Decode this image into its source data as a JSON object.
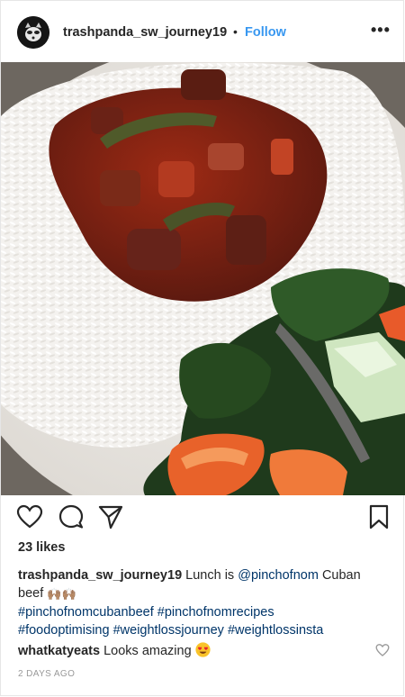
{
  "header": {
    "username": "trashpanda_sw_journey19",
    "separator": "•",
    "follow_label": "Follow",
    "more_label": "•••"
  },
  "icons": {
    "like": "heart-outline-icon",
    "comment": "speech-bubble-icon",
    "share": "paper-plane-icon",
    "save": "bookmark-icon"
  },
  "likes": "23 likes",
  "caption": {
    "username": "trashpanda_sw_journey19",
    "text_before": "Lunch is",
    "mention": "@pinchofnom",
    "text_after": "Cuban beef",
    "emoji": "🙌🏽🙌🏽",
    "hashtags": [
      "#pinchofnomcubanbeef",
      "#pinchofnomrecipes",
      "#foodoptimising",
      "#weightlossjourney",
      "#weightlossinsta"
    ]
  },
  "comment": {
    "username": "whatkatyeats",
    "text": "Looks amazing",
    "emoji": "heart-eyes-emoji"
  },
  "timestamp": "2 DAYS AGO",
  "colors": {
    "link": "#003569",
    "follow": "#3897f0",
    "muted": "#999999"
  }
}
